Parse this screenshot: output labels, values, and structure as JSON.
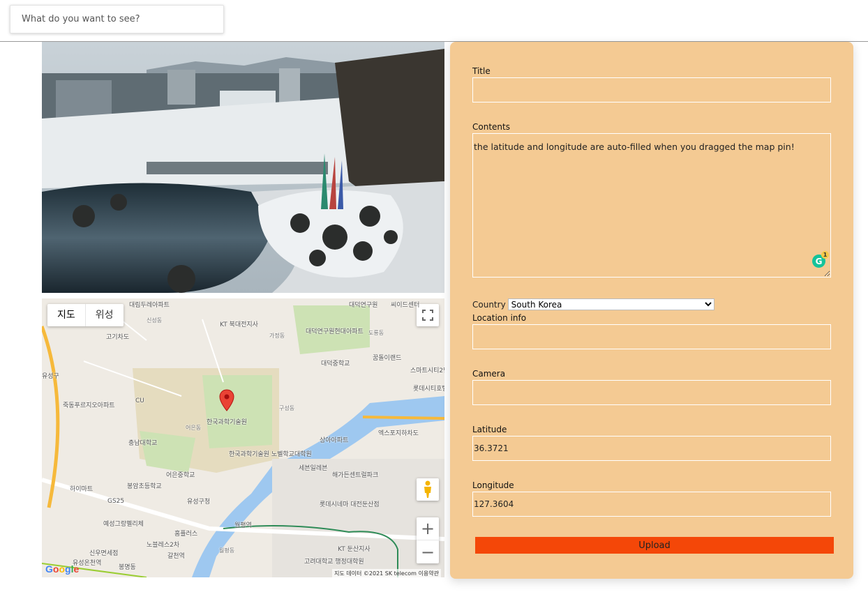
{
  "search": {
    "placeholder": "What do you want to see?"
  },
  "map": {
    "type_buttons": [
      "지도",
      "위성"
    ],
    "labels": [
      "대림두레아파트",
      "KT 북대전지사",
      "대덕연구원",
      "씨이드센터",
      "신성동",
      "도룡동",
      "고기차도",
      "대덕연구원현대아파트",
      "가정동",
      "꿈돌이랜드",
      "대덕중학교",
      "스마트시티2단지",
      "유성구",
      "롯데시티호텔",
      "죽동푸르지오아파트",
      "CU",
      "한국과학기술원",
      "구성동",
      "충남대학교",
      "한국과학기술원 노벨학교대학원",
      "어은동",
      "상아아파트",
      "엑스포지하차도",
      "세븐일레븐",
      "해가든센트럴파크",
      "봉암초등학교",
      "어은중학교",
      "유성구청",
      "GS25",
      "하이마트",
      "롯데시네마 대전둔산점",
      "예성그랑펠리체",
      "홈플러스",
      "월평역",
      "노블레스2차",
      "갈천역",
      "월평동",
      "고려대학교 행정대학원",
      "KT 둔산지사",
      "유성온천역",
      "신우면세점",
      "봉명동"
    ],
    "attribution": "지도 데이터 ©2021 SK telecom   이용약관"
  },
  "form": {
    "title_label": "Title",
    "title_value": "",
    "contents_label": "Contents",
    "contents_value": "the latitude and longitude are auto-filled when you dragged the map pin!",
    "country_label": "Country",
    "country_value": "South Korea",
    "location_label": "Location info",
    "location_value": "",
    "camera_label": "Camera",
    "camera_value": "",
    "latitude_label": "Latitude",
    "latitude_value": "36.3721",
    "longitude_label": "Longitude",
    "longitude_value": "127.3604",
    "upload_label": "Upload",
    "grammarly_count": "1"
  },
  "icons": {
    "fullscreen": "fullscreen-icon",
    "pegman": "street-view-icon",
    "pin": "map-pin-icon"
  }
}
